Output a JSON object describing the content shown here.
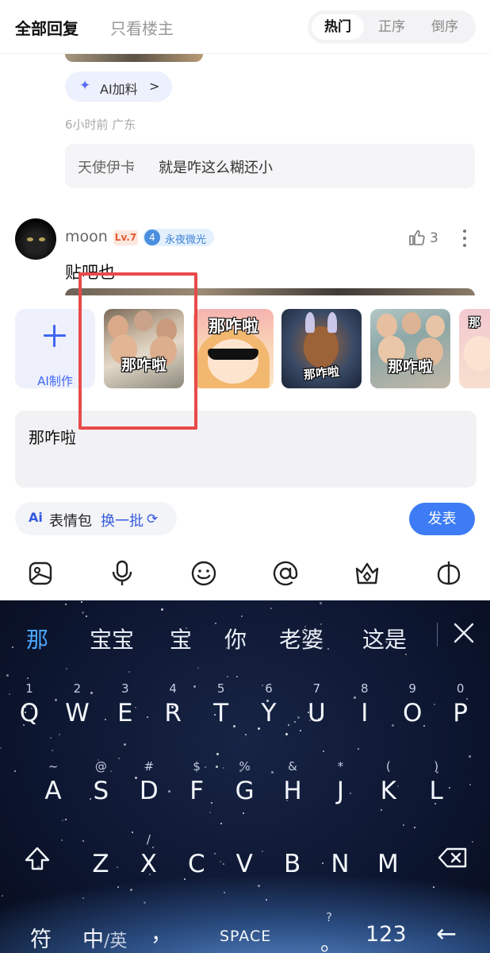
{
  "header": {
    "tab_all": "全部回复",
    "tab_owner": "只看楼主",
    "sort": [
      "热门",
      "正序",
      "倒序"
    ],
    "sort_selected": "热门"
  },
  "reply_prev": {
    "ai_chip_label": "AI加料",
    "ai_chip_chevron": ">",
    "time_location": "6小时前 广东",
    "sub_reply_user": "天使伊卡",
    "sub_reply_sep": " : ",
    "sub_reply_text": "就是咋这么糊还小"
  },
  "comment": {
    "username": "moon",
    "level": "Lv.7",
    "fan_badge_num": "4",
    "fan_badge_text": "永夜微光",
    "like_count": "3",
    "text": "贴吧也"
  },
  "stickers": {
    "ai_make_label": "AI制作",
    "items": [
      {
        "caption": "那咋啦"
      },
      {
        "caption": "那咋啦"
      },
      {
        "caption": "那咋啦"
      },
      {
        "caption": "那咋啦"
      },
      {
        "caption": "那"
      }
    ]
  },
  "composer": {
    "input_value": "那咋啦",
    "ai_icon": "Ai",
    "emoji_pack_label": "表情包",
    "swap_label": "换一批",
    "send_label": "发表"
  },
  "toolbar_icons": [
    "image-icon",
    "microphone-icon",
    "smiley-icon",
    "at-icon",
    "gift-icon",
    "more-apps-icon"
  ],
  "keyboard": {
    "candidates": [
      "那",
      "宝宝",
      "宝",
      "你",
      "老婆",
      "这是"
    ],
    "row1": [
      {
        "main": "Q",
        "sub": "1"
      },
      {
        "main": "W",
        "sub": "2"
      },
      {
        "main": "E",
        "sub": "3"
      },
      {
        "main": "R",
        "sub": "4"
      },
      {
        "main": "T",
        "sub": "5"
      },
      {
        "main": "Y",
        "sub": "6"
      },
      {
        "main": "U",
        "sub": "7"
      },
      {
        "main": "I",
        "sub": "8"
      },
      {
        "main": "O",
        "sub": "9"
      },
      {
        "main": "P",
        "sub": "0"
      }
    ],
    "row2": [
      {
        "main": "A",
        "sub": "~"
      },
      {
        "main": "S",
        "sub": "@"
      },
      {
        "main": "D",
        "sub": "#"
      },
      {
        "main": "F",
        "sub": "$"
      },
      {
        "main": "G",
        "sub": "%"
      },
      {
        "main": "H",
        "sub": "&"
      },
      {
        "main": "J",
        "sub": "*"
      },
      {
        "main": "K",
        "sub": "("
      },
      {
        "main": "L",
        "sub": ")"
      }
    ],
    "row3": [
      {
        "main": "Z",
        "sub": ""
      },
      {
        "main": "X",
        "sub": "/"
      },
      {
        "main": "C",
        "sub": ""
      },
      {
        "main": "V",
        "sub": ""
      },
      {
        "main": "B",
        "sub": ""
      },
      {
        "main": "N",
        "sub": ""
      },
      {
        "main": "M",
        "sub": ""
      }
    ],
    "symbol_key": "符",
    "lang_key": "中",
    "lang_sub": "/英",
    "comma_key": "，",
    "space_label": "SPACE",
    "question_key": "?",
    "period_key": "。",
    "num_key": "123",
    "enter_key": "←"
  }
}
